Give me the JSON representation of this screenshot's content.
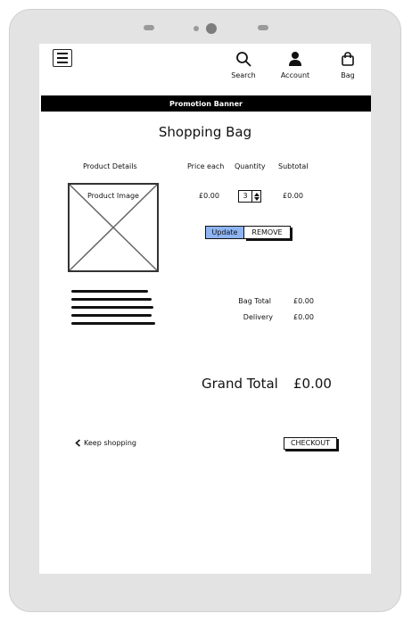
{
  "header": {
    "search_label": "Search",
    "account_label": "Account",
    "bag_label": "Bag"
  },
  "banner": {
    "text": "Promotion Banner"
  },
  "page_title": "Shopping Bag",
  "table": {
    "columns": [
      "Product Details",
      "Price each",
      "Quantity",
      "Subtotal"
    ],
    "item": {
      "image_label": "Product Image",
      "price": "£0.00",
      "quantity": "3",
      "subtotal": "£0.00"
    }
  },
  "actions": {
    "update_label": "Update",
    "remove_label": "REMOVE"
  },
  "summary": {
    "bag_total_label": "Bag Total",
    "bag_total_value": "£0.00",
    "delivery_label": "Delivery",
    "delivery_value": "£0.00",
    "grand_total_label": "Grand Total",
    "grand_total_value": "£0.00"
  },
  "footer": {
    "keep_shopping_label": "Keep shopping",
    "checkout_label": "CHECKOUT"
  },
  "icons": {
    "menu": "hamburger-menu-icon",
    "search": "search-icon",
    "account": "user-icon",
    "bag": "shopping-bag-icon",
    "back": "chevron-left-icon"
  },
  "colors": {
    "update_button": "#8eb4f2",
    "banner_background": "#000000",
    "device_frame": "#e3e3e3"
  }
}
